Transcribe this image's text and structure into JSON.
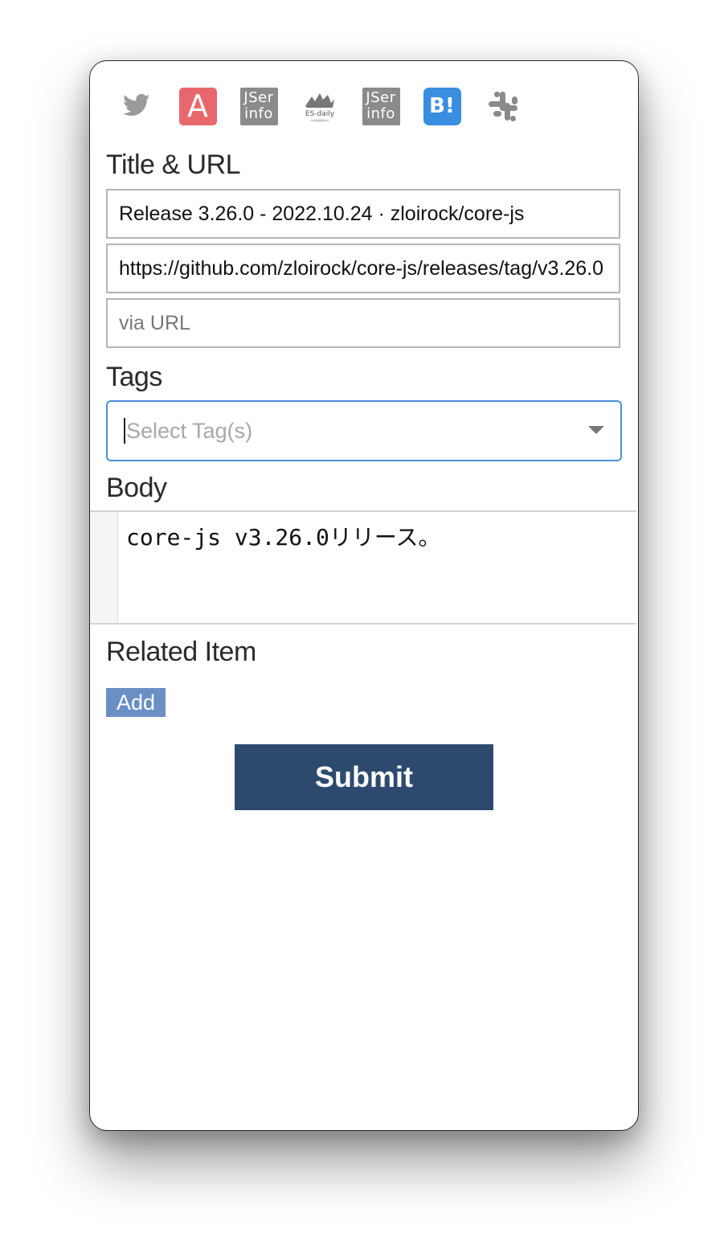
{
  "toolbar": {
    "icons": [
      {
        "name": "twitter-icon"
      },
      {
        "name": "asciidoc-icon",
        "glyph": "A"
      },
      {
        "name": "jser-info-icon",
        "line1": "JSer",
        "line2": "info"
      },
      {
        "name": "es-daily-icon",
        "text": "ES-daily"
      },
      {
        "name": "jser-info-icon-2",
        "line1": "JSer",
        "line2": "info"
      },
      {
        "name": "hatena-bookmark-icon",
        "text": "B!"
      },
      {
        "name": "slack-icon"
      }
    ]
  },
  "title_url": {
    "label": "Title & URL",
    "title_value": "Release 3.26.0 - 2022.10.24 · zloirock/core-js",
    "url_value": "https://github.com/zloirock/core-js/releases/tag/v3.26.0",
    "via_placeholder": "via URL"
  },
  "tags": {
    "label": "Tags",
    "placeholder": "Select Tag(s)"
  },
  "body": {
    "label": "Body",
    "content": "core-js v3.26.0リリース。"
  },
  "related": {
    "label": "Related Item",
    "add_label": "Add"
  },
  "submit_label": "Submit",
  "colors": {
    "primary": "#2d4a6e",
    "add_button": "#6a8fc5",
    "focus_border": "#4a90d9"
  }
}
